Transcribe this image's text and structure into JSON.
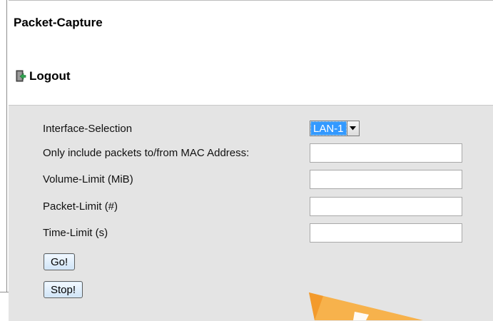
{
  "page": {
    "title": "Packet-Capture",
    "logout_label": "Logout"
  },
  "form": {
    "interface_label": "Interface-Selection",
    "interface_selected": "LAN-1",
    "mac_label": "Only include packets to/from MAC Address:",
    "mac_value": "",
    "volume_label": "Volume-Limit (MiB)",
    "volume_value": "",
    "packet_label": "Packet-Limit (#)",
    "packet_value": "",
    "time_label": "Time-Limit (s)",
    "time_value": ""
  },
  "buttons": {
    "go_label": "Go!",
    "stop_label": "Stop!"
  },
  "colors": {
    "panel_bg": "#e4e4e4",
    "select_highlight": "#3399ff",
    "button_bg": "#cfe4f7",
    "overlay_orange": "#f6b04b"
  },
  "icons": {
    "logout": "logout-door-icon",
    "dropdown": "chevron-down-icon"
  }
}
